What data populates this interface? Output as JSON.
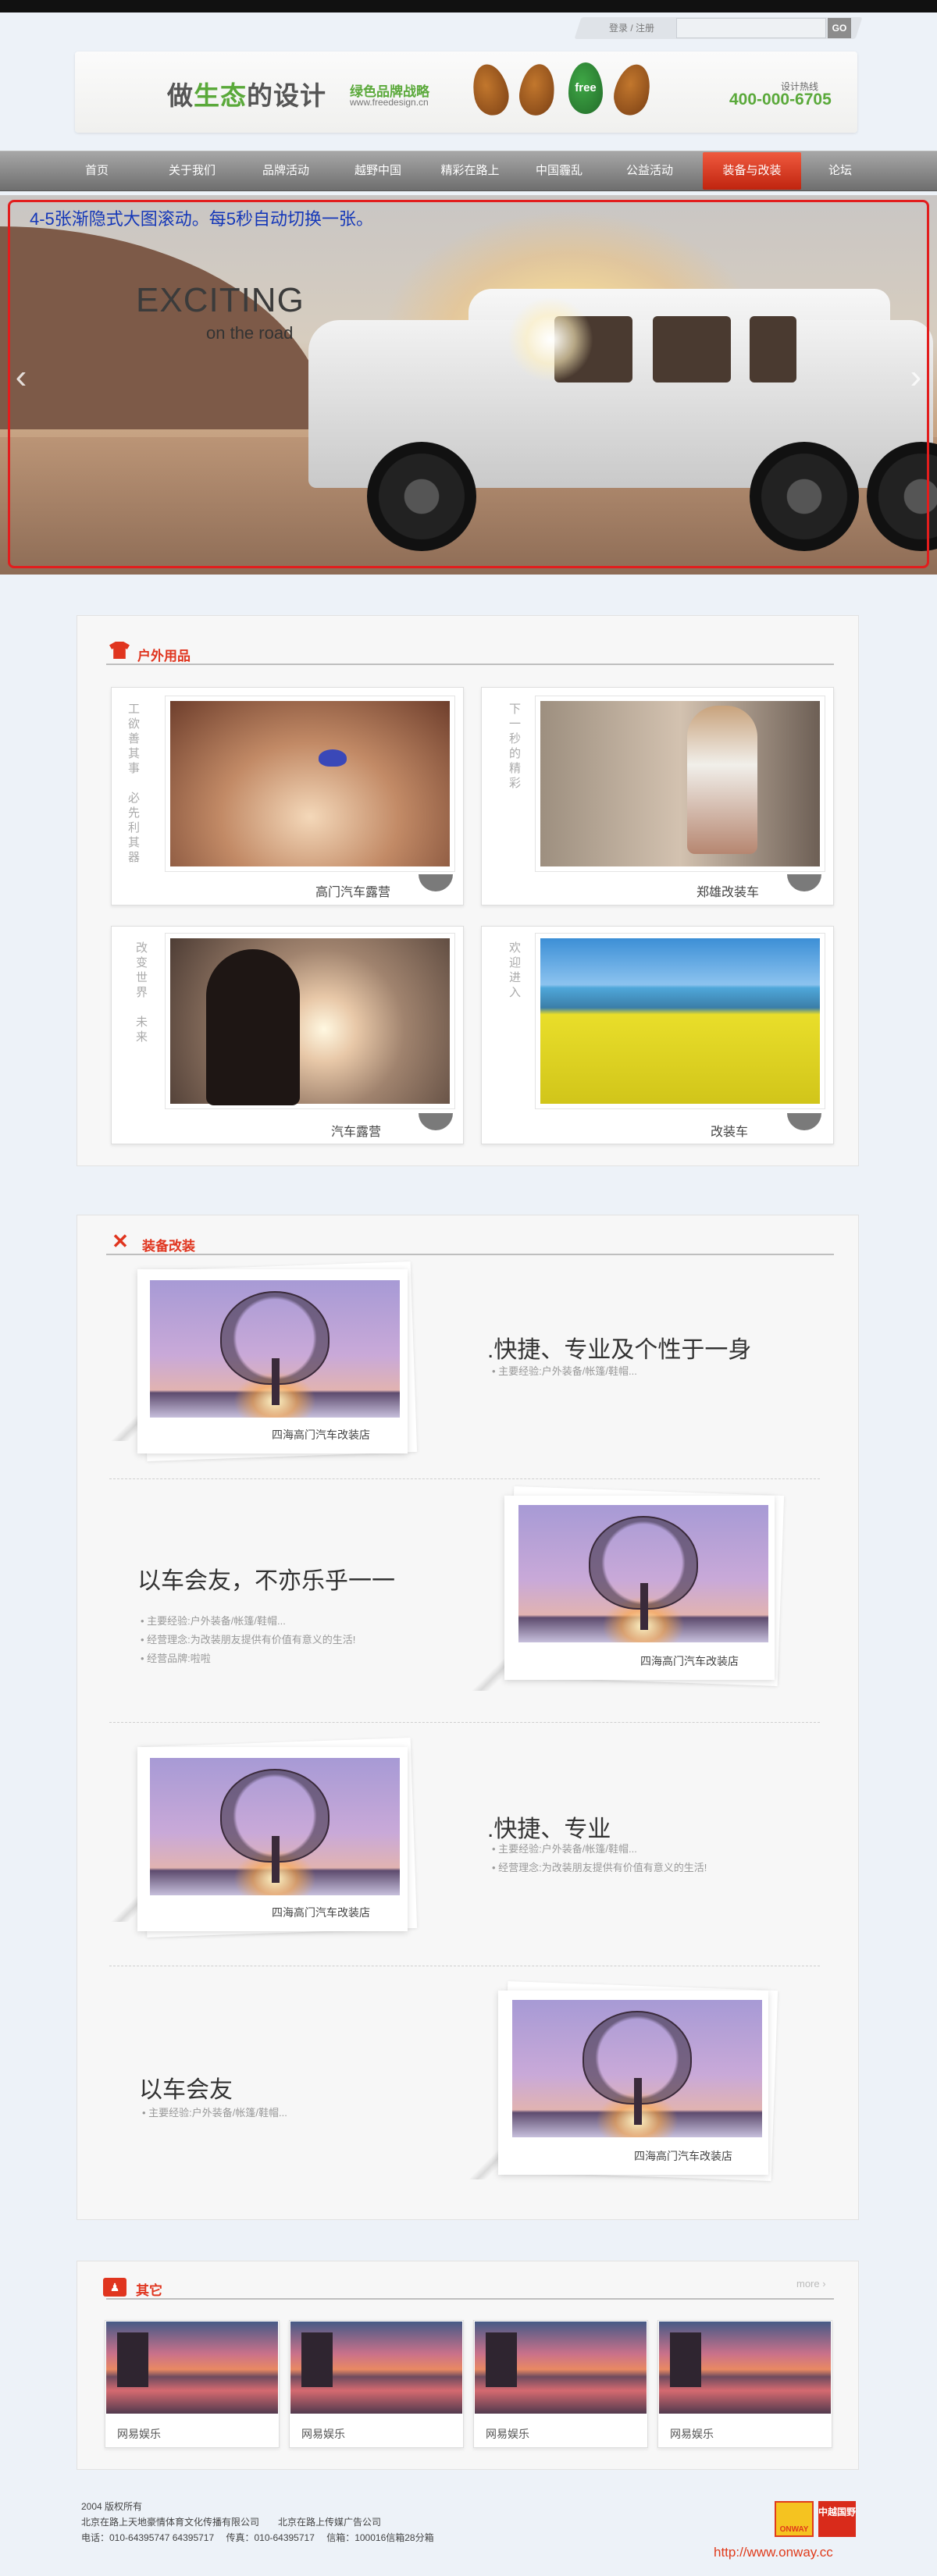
{
  "topbar": {
    "login_text": "登录 / 注册",
    "go_label": "GO",
    "search_placeholder": ""
  },
  "header": {
    "logo_part1": "做",
    "logo_green": "生态",
    "logo_part2": "的设计",
    "logo_sub": "绿色品牌战略",
    "logo_url": "www.freedesign.cn",
    "leaf_free": "free",
    "hotline_label": "设计热线",
    "hotline_number": "400-000-6705"
  },
  "nav": {
    "items": [
      {
        "label": "首页"
      },
      {
        "label": "关于我们"
      },
      {
        "label": "品牌活动"
      },
      {
        "label": "越野中国"
      },
      {
        "label": "精彩在路上"
      },
      {
        "label": "中国霾乱"
      },
      {
        "label": "公益活动"
      },
      {
        "label": "装备与改装"
      },
      {
        "label": "论坛"
      }
    ],
    "active_index": 7,
    "active_color": "#d9321a"
  },
  "slider": {
    "note": "4-5张渐隐式大图滚动。每5秒自动切换一张。",
    "headline": "EXCITING",
    "subline": "on the road",
    "prev_arrow": "‹",
    "next_arrow": "›"
  },
  "outdoor": {
    "title": "户外用品",
    "cards": [
      {
        "vert_text": "工欲善其事　必先利其器",
        "caption": "高门汽车露营"
      },
      {
        "vert_text": "下一秒的精彩",
        "caption": "郑雄改装车"
      },
      {
        "vert_text": "改变世界　未来",
        "caption": "汽车露营"
      },
      {
        "vert_text": "欢迎进入",
        "caption": "改装车"
      }
    ]
  },
  "equipment": {
    "title": "装备改装",
    "rows": [
      {
        "photo_caption": "四海高门汽车改装店",
        "title": ".快捷、专业及个性于一身",
        "lines": [
          "• 主要经验:户外装备/帐篷/鞋帽..."
        ]
      },
      {
        "photo_caption": "四海高门汽车改装店",
        "title": "以车会友，不亦乐乎一一",
        "lines": [
          "• 主要经验:户外装备/帐篷/鞋帽...",
          "• 经营理念:为改装朋友提供有价值有意义的生活!",
          "• 经营品牌:啦啦"
        ]
      },
      {
        "photo_caption": "四海高门汽车改装店",
        "title": ".快捷、专业",
        "lines": [
          "• 主要经验:户外装备/帐篷/鞋帽...",
          "• 经营理念:为改装朋友提供有价值有意义的生活!"
        ]
      },
      {
        "photo_caption": "四海高门汽车改装店",
        "title": "以车会友",
        "lines": [
          "• 主要经验:户外装备/帐篷/鞋帽..."
        ]
      }
    ]
  },
  "others": {
    "title": "其它",
    "more": "more",
    "items": [
      {
        "caption": "网易娱乐"
      },
      {
        "caption": "网易娱乐"
      },
      {
        "caption": "网易娱乐"
      },
      {
        "caption": "网易娱乐"
      }
    ]
  },
  "footer": {
    "line1": "2004 版权所有",
    "line2": "北京在路上天地豪情体育文化传播有限公司　　北京在路上传媒广告公司",
    "line3": "电话：010-64395747 64395717　 传真：010-64395717　 信箱：100016信箱28分箱",
    "logo1": "ONWAY",
    "logo2": "中越国野",
    "url": "http://www.onway.cc"
  }
}
